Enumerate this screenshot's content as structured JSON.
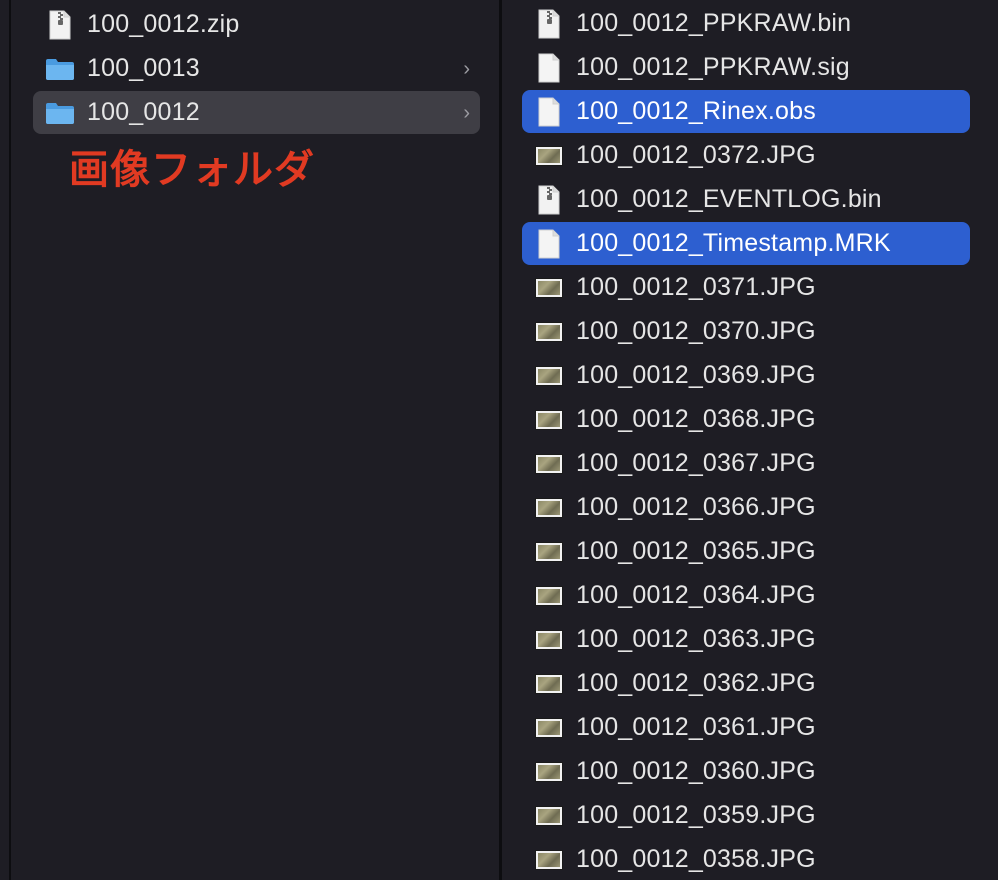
{
  "left_column": {
    "items": [
      {
        "name": "100_0012.zip",
        "kind": "zip-file"
      },
      {
        "name": "100_0013",
        "kind": "folder"
      },
      {
        "name": "100_0012",
        "kind": "folder",
        "state": "selected-inactive"
      }
    ],
    "annotation": "画像フォルダ",
    "annotation_color": "#e13a22"
  },
  "right_column": {
    "items": [
      {
        "name": "100_0012_PPKRAW.bin",
        "kind": "zip-file"
      },
      {
        "name": "100_0012_PPKRAW.sig",
        "kind": "document"
      },
      {
        "name": "100_0012_Rinex.obs",
        "kind": "document",
        "state": "selected"
      },
      {
        "name": "100_0012_0372.JPG",
        "kind": "image"
      },
      {
        "name": "100_0012_EVENTLOG.bin",
        "kind": "zip-file"
      },
      {
        "name": "100_0012_Timestamp.MRK",
        "kind": "document",
        "state": "selected"
      },
      {
        "name": "100_0012_0371.JPG",
        "kind": "image"
      },
      {
        "name": "100_0012_0370.JPG",
        "kind": "image"
      },
      {
        "name": "100_0012_0369.JPG",
        "kind": "image"
      },
      {
        "name": "100_0012_0368.JPG",
        "kind": "image"
      },
      {
        "name": "100_0012_0367.JPG",
        "kind": "image"
      },
      {
        "name": "100_0012_0366.JPG",
        "kind": "image"
      },
      {
        "name": "100_0012_0365.JPG",
        "kind": "image"
      },
      {
        "name": "100_0012_0364.JPG",
        "kind": "image"
      },
      {
        "name": "100_0012_0363.JPG",
        "kind": "image"
      },
      {
        "name": "100_0012_0362.JPG",
        "kind": "image"
      },
      {
        "name": "100_0012_0361.JPG",
        "kind": "image"
      },
      {
        "name": "100_0012_0360.JPG",
        "kind": "image"
      },
      {
        "name": "100_0012_0359.JPG",
        "kind": "image"
      },
      {
        "name": "100_0012_0358.JPG",
        "kind": "image"
      }
    ]
  },
  "colors": {
    "background": "#1e1d24",
    "selection": "#2d5fd0",
    "inactive_selection": "#3f3e45",
    "folder": "#5aa9e6"
  },
  "icons": {
    "chevron": "chevron-right-icon",
    "zip-file": "zip-file-icon",
    "document": "document-icon",
    "folder": "folder-icon",
    "image": "image-thumbnail-icon"
  }
}
